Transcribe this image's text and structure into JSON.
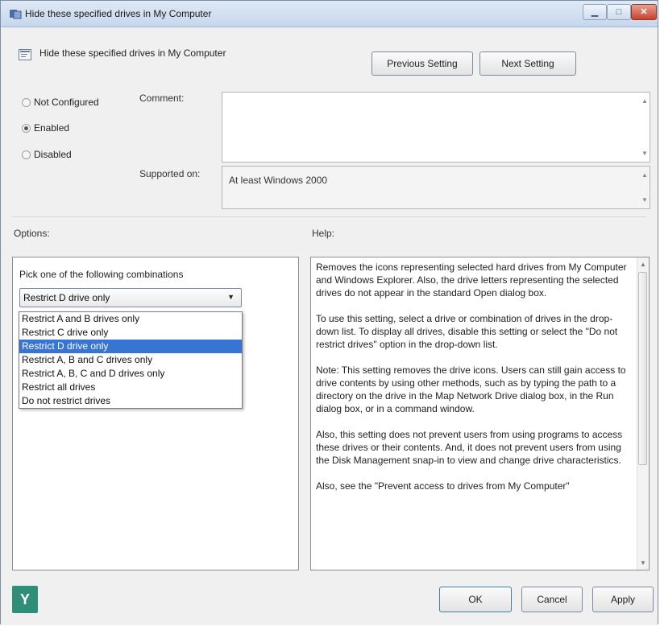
{
  "window": {
    "title": "Hide these specified drives in My Computer"
  },
  "header": {
    "setting_title": "Hide these specified drives in My Computer",
    "previous_button": "Previous Setting",
    "next_button": "Next Setting"
  },
  "state": {
    "options": [
      "Not Configured",
      "Enabled",
      "Disabled"
    ],
    "selected": "Enabled"
  },
  "comment": {
    "label": "Comment:",
    "value": ""
  },
  "supported": {
    "label": "Supported on:",
    "value": "At least Windows 2000"
  },
  "options_panel": {
    "label": "Options:",
    "caption": "Pick one of the following combinations",
    "selected": "Restrict D drive only",
    "items": [
      "Restrict A and B drives only",
      "Restrict C drive only",
      "Restrict D drive only",
      "Restrict A, B and C drives only",
      "Restrict A, B, C and D drives only",
      "Restrict all drives",
      "Do not restrict drives"
    ]
  },
  "help_panel": {
    "label": "Help:",
    "paragraphs": [
      "Removes the icons representing selected hard drives from My Computer and Windows Explorer. Also, the drive letters representing the selected drives do not appear in the standard Open dialog box.",
      "To use this setting, select a drive or combination of drives in the drop-down list. To display all drives, disable this setting or select the \"Do not restrict drives\" option in the drop-down list.",
      "Note: This setting removes the drive icons. Users can still gain access to drive contents by using other methods, such as by typing the path to a directory on the drive in the Map Network Drive dialog box, in the Run dialog box, or in a command window.",
      "Also, this setting does not prevent users from using programs to access these drives or their contents. And, it does not prevent users from using the Disk Management snap-in to view and change drive characteristics.",
      "Also, see the \"Prevent access to drives from My Computer\""
    ]
  },
  "footer": {
    "ok": "OK",
    "cancel": "Cancel",
    "apply": "Apply"
  },
  "icons": {
    "title_icon": "policy-icon",
    "header_icon": "policy-icon",
    "footer_icon": "app-logo-icon",
    "accent_color": "#2f8e78",
    "selection_color": "#3874d1"
  }
}
